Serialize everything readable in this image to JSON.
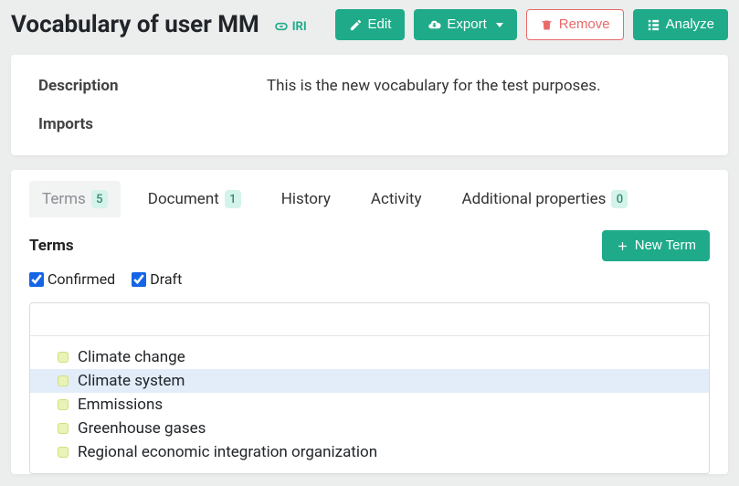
{
  "header": {
    "title": "Vocabulary of user MM",
    "iri_label": "IRI",
    "buttons": {
      "edit": "Edit",
      "export": "Export",
      "remove": "Remove",
      "analyze": "Analyze"
    }
  },
  "meta": {
    "description_label": "Description",
    "description_value": "This is the new vocabulary for the test purposes.",
    "imports_label": "Imports",
    "imports_value": ""
  },
  "tabs": {
    "terms": {
      "label": "Terms",
      "count": "5"
    },
    "document": {
      "label": "Document",
      "count": "1"
    },
    "history": {
      "label": "History"
    },
    "activity": {
      "label": "Activity"
    },
    "additional": {
      "label": "Additional properties",
      "count": "0"
    }
  },
  "terms_section": {
    "heading": "Terms",
    "new_term": "New Term",
    "filter_confirmed": "Confirmed",
    "filter_draft": "Draft",
    "items": [
      {
        "label": "Climate change"
      },
      {
        "label": "Climate system"
      },
      {
        "label": "Emmissions"
      },
      {
        "label": "Greenhouse gases"
      },
      {
        "label": "Regional economic integration organization"
      }
    ],
    "selected_index": 1
  }
}
